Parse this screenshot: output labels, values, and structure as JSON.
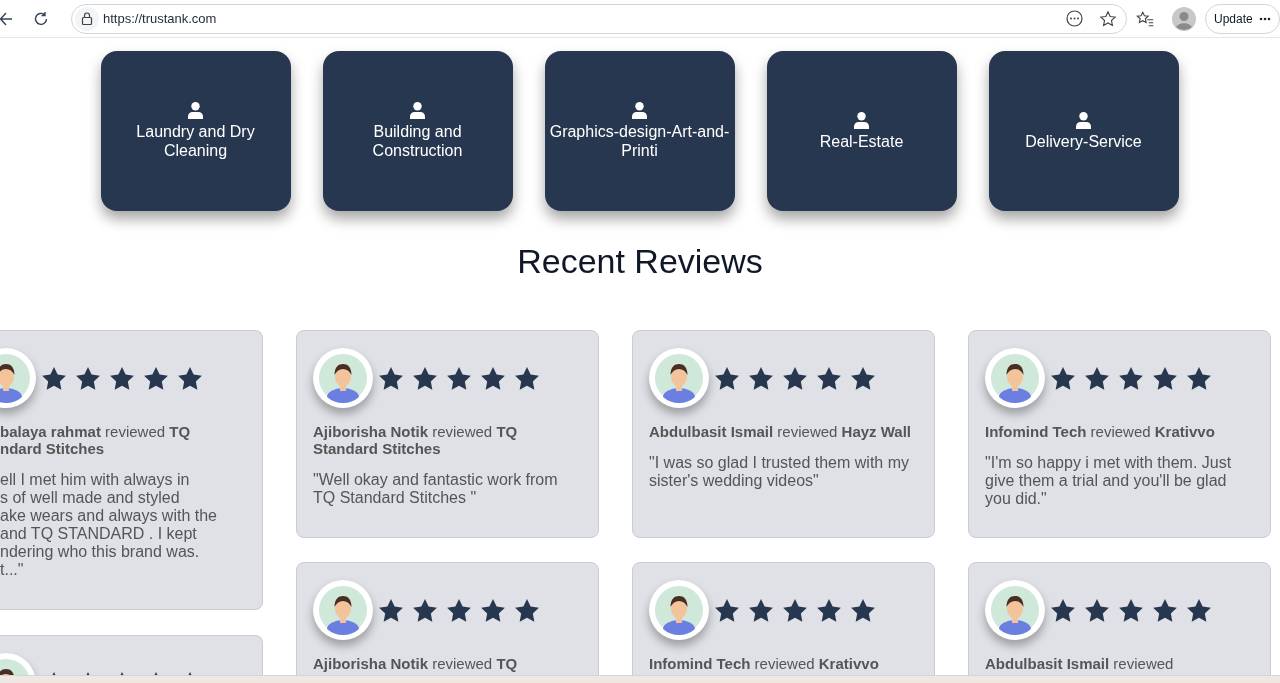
{
  "browser": {
    "url": "https://trustank.com",
    "update_label": "Update"
  },
  "categories": [
    {
      "label": "Laundry and Dry Cleaning"
    },
    {
      "label": "Building and Construction"
    },
    {
      "label": "Graphics-design-Art-and-Printi"
    },
    {
      "label": "Real-Estate"
    },
    {
      "label": "Delivery-Service"
    }
  ],
  "section_title": "Recent Reviews",
  "columns": [
    [
      {
        "kind": "clipped",
        "stars": 5,
        "heading_lines": [
          "**balaya rahmat** reviewed **TQ**",
          "**ndard Stitches**"
        ],
        "quote_lines": [
          "ell I met him with always in",
          "s of well made and styled",
          "ake wears and always with the",
          "and TQ STANDARD . I kept",
          "ndering who this brand was.",
          "t...\""
        ]
      },
      {
        "kind": "clipped",
        "stars": 5
      }
    ],
    [
      {
        "kind": "full",
        "stars": 5,
        "heading": "**Ajiborisha Notik** reviewed **TQ Standard Stitches**",
        "quote": "\"Well okay and fantastic work from TQ Standard Stitches \""
      },
      {
        "kind": "full",
        "stars": 5,
        "heading": "**Ajiborisha Notik** reviewed **TQ**"
      }
    ],
    [
      {
        "kind": "full",
        "stars": 5,
        "heading": "**Abdulbasit Ismail** reviewed **Hayz Wall**",
        "quote": "\"I was so glad I trusted them with my sister's wedding videos\""
      },
      {
        "kind": "full",
        "stars": 5,
        "heading": "**Infomind Tech** reviewed **Krativvo**"
      }
    ],
    [
      {
        "kind": "full",
        "stars": 5,
        "heading": "**Infomind Tech** reviewed **Krativvo**",
        "quote": "\"I'm so happy i met with them. Just give them a trial and you'll be glad you did.\""
      },
      {
        "kind": "full",
        "stars": 5,
        "heading": "**Abdulbasit Ismail** reviewed"
      }
    ]
  ]
}
